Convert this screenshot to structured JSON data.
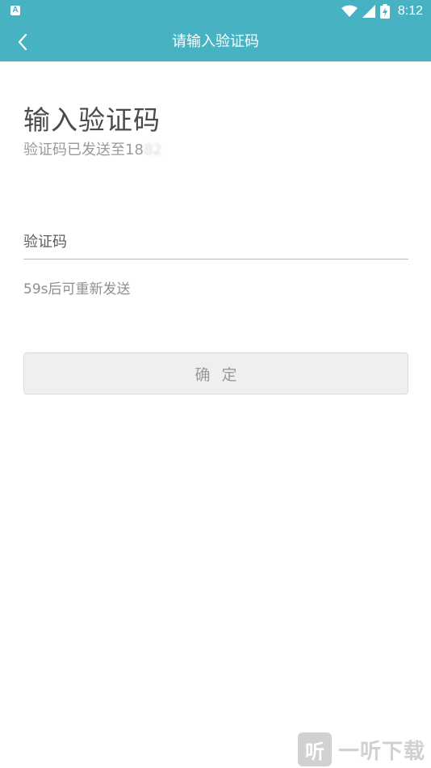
{
  "status_bar": {
    "notification_icon": "A",
    "time": "8:12",
    "icons": [
      "wifi-icon",
      "cell-signal-icon",
      "battery-icon"
    ],
    "battery_label": "⚡"
  },
  "app_bar": {
    "title": "请输入验证码",
    "back_icon": "chevron-left-icon",
    "background": "#47b2c2"
  },
  "main": {
    "heading": "输入验证码",
    "sent_prefix": "验证码已发送至",
    "phone_visible": "18",
    "phone_masked": "82",
    "code_placeholder": "验证码",
    "code_value": "",
    "resend_text": "59s后可重新发送",
    "confirm_label": "确定"
  },
  "watermark": {
    "logo_text": "听",
    "text": "一听下载"
  },
  "colors": {
    "accent": "#47b2c2",
    "button_bg": "#efefef",
    "button_text": "#9a9a9a"
  }
}
